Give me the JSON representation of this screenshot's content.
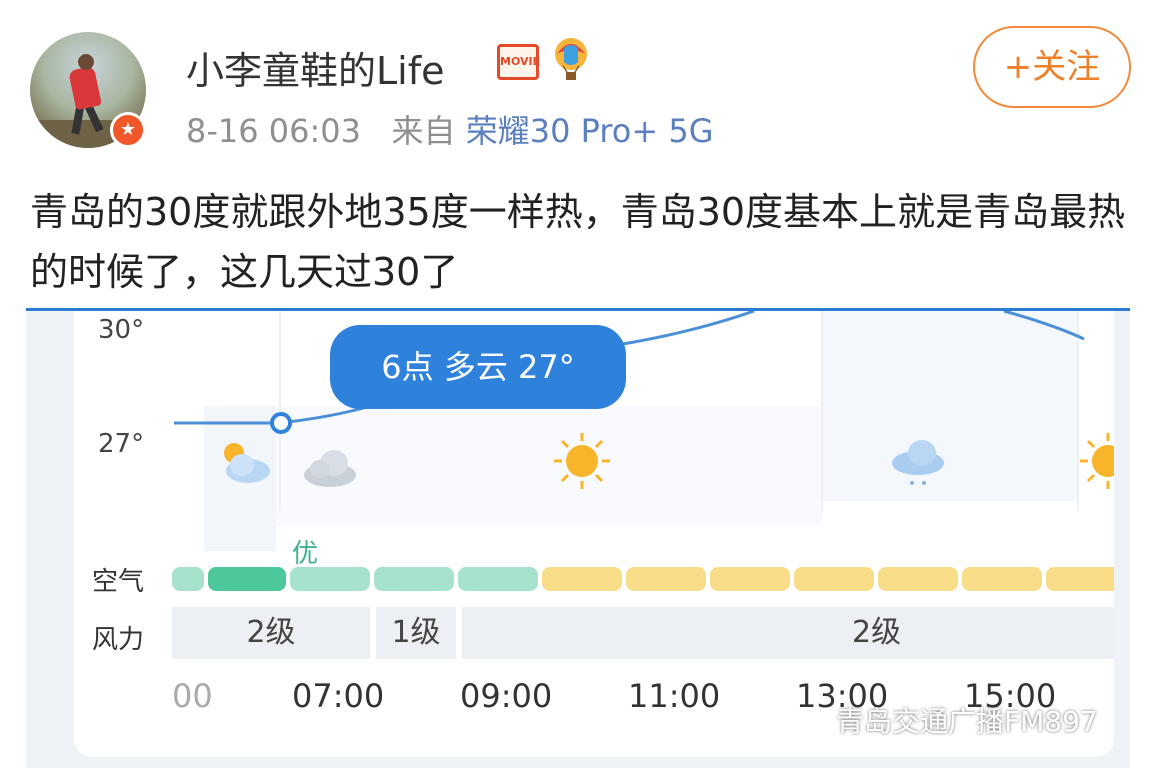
{
  "post": {
    "username": "小李童鞋的Life",
    "movie_badge": "MOVIE",
    "timestamp": "8-16 06:03",
    "from_label": "来自",
    "device": "荣耀30 Pro+ 5G",
    "follow_label": "+关注",
    "text": "青岛的30度就跟外地35度一样热，青岛30度基本上就是青岛最热的时候了，这几天过30了"
  },
  "weather": {
    "y_labels": [
      "30°",
      "27°"
    ],
    "tooltip": "6点 多云 27°",
    "aqi_label": "空气",
    "aqi_good": "优",
    "wind_label": "风力",
    "wind_levels": [
      "2级",
      "1级",
      "2级"
    ],
    "time_labels": [
      "00",
      "07:00",
      "09:00",
      "11:00",
      "13:00",
      "15:00"
    ],
    "icons": [
      "partly-cloudy-icon",
      "cloudy-icon",
      "sunny-icon",
      "light-rain-icon",
      "sunny-icon"
    ],
    "aqi_colors": {
      "good": "#7fd8b8",
      "good_selected": "#4cc89a",
      "moderate": "#f8dc88"
    }
  },
  "watermark": "青岛交通广播FM897"
}
